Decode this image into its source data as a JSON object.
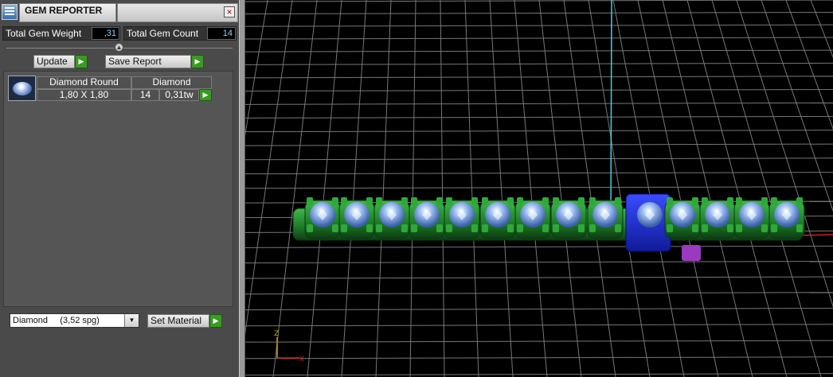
{
  "window": {
    "title": "GEM REPORTER",
    "close_label": "×",
    "icon": "gem-reporter-app-icon"
  },
  "stats": {
    "weight_label": "Total Gem Weight",
    "weight_value": ",31",
    "count_label": "Total Gem Count",
    "count_value": "14"
  },
  "toolbar": {
    "update_label": "Update",
    "save_report_label": "Save Report"
  },
  "gem_list": [
    {
      "name": "Diamond Round",
      "material": "Diamond",
      "size": "1,80 X 1,80",
      "count": "14",
      "weight": "0,31tw",
      "icon": "round-diamond-icon"
    }
  ],
  "material": {
    "selected": "Diamond     (3,52 spg)",
    "set_label": "Set Material"
  },
  "viewport": {
    "axis_labels": {
      "x": "X",
      "z": "Z"
    },
    "colors": {
      "grid": "#8c8c8c",
      "metal": "#1f8a2a",
      "gem": "#8fb8f2",
      "selected": "#1a2acc",
      "axis_vertical": "#3fd0e0",
      "axis_horizontal": "#d02020"
    }
  }
}
